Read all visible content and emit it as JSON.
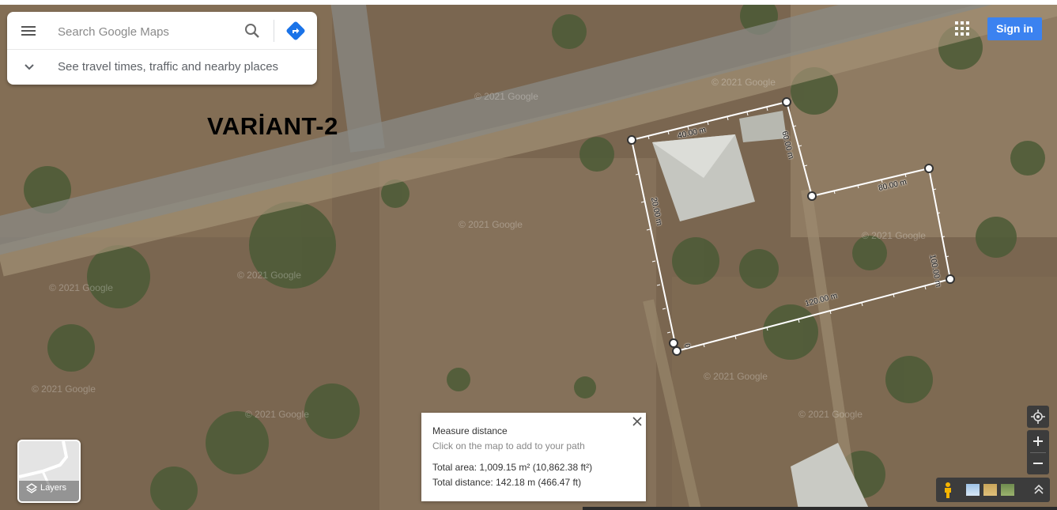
{
  "search": {
    "placeholder": "Search Google Maps",
    "travel_prompt": "See travel times, traffic and nearby places"
  },
  "overlay_title": "VARİANT-2",
  "header": {
    "sign_in_label": "Sign in"
  },
  "map": {
    "watermark": "© 2021 Google",
    "measurement_labels": [
      "40.00 m",
      "60.00 m",
      "80.00 m",
      "100.00 m",
      "120.00 m",
      "20.00 m",
      "0"
    ]
  },
  "measure_panel": {
    "title": "Measure distance",
    "subtitle": "Click on the map to add to your path",
    "total_area": "Total area: 1,009.15 m² (10,862.38 ft²)",
    "total_distance": "Total distance: 142.18 m (466.47 ft)"
  },
  "layers": {
    "label": "Layers"
  },
  "icons": [
    "menu-icon",
    "search-icon",
    "directions-icon",
    "chevron-down-icon",
    "apps-icon",
    "close-icon",
    "layers-icon",
    "my-location-icon",
    "zoom-in-icon",
    "zoom-out-icon",
    "pegman-icon",
    "expand-icon"
  ],
  "colors": {
    "sign_in_bg": "#3b82f0",
    "directions_accent": "#1a73e8"
  }
}
